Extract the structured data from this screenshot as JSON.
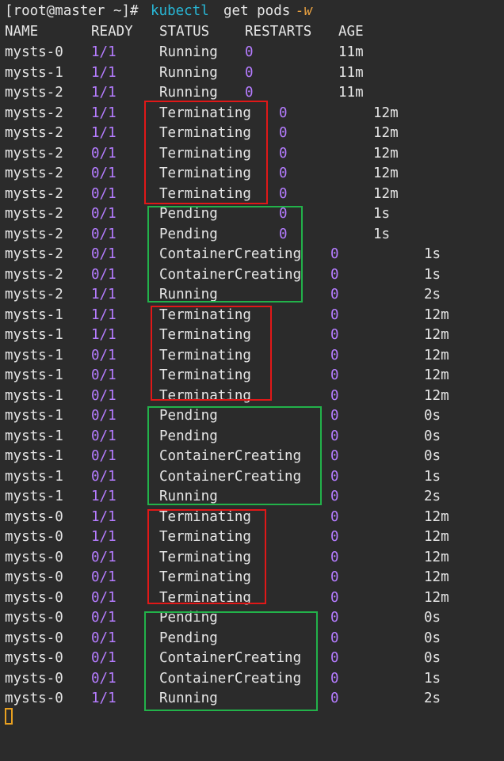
{
  "terminal": {
    "prompt": "[root@master ~]#",
    "command": "kubectl",
    "args": "get pods",
    "flag": "-w",
    "header": {
      "name": "NAME",
      "ready": "READY",
      "status": "STATUS",
      "restarts": "RESTARTS",
      "age": "AGE"
    },
    "rows": [
      {
        "name": "mysts-0",
        "ready": "1/1",
        "status": "Running",
        "restarts": "0",
        "age": "11m"
      },
      {
        "name": "mysts-1",
        "ready": "1/1",
        "status": "Running",
        "restarts": "0",
        "age": "11m"
      },
      {
        "name": "mysts-2",
        "ready": "1/1",
        "status": "Running",
        "restarts": "0",
        "age": "11m"
      },
      {
        "name": "mysts-2",
        "ready": "1/1",
        "status": "Terminating",
        "restarts": "0",
        "age": "12m"
      },
      {
        "name": "mysts-2",
        "ready": "1/1",
        "status": "Terminating",
        "restarts": "0",
        "age": "12m"
      },
      {
        "name": "mysts-2",
        "ready": "0/1",
        "status": "Terminating",
        "restarts": "0",
        "age": "12m"
      },
      {
        "name": "mysts-2",
        "ready": "0/1",
        "status": "Terminating",
        "restarts": "0",
        "age": "12m"
      },
      {
        "name": "mysts-2",
        "ready": "0/1",
        "status": "Terminating",
        "restarts": "0",
        "age": "12m"
      },
      {
        "name": "mysts-2",
        "ready": "0/1",
        "status": "Pending",
        "restarts": "0",
        "age": "1s"
      },
      {
        "name": "mysts-2",
        "ready": "0/1",
        "status": "Pending",
        "restarts": "0",
        "age": "1s"
      },
      {
        "name": "mysts-2",
        "ready": "0/1",
        "status": "ContainerCreating",
        "restarts": "0",
        "age": "1s"
      },
      {
        "name": "mysts-2",
        "ready": "0/1",
        "status": "ContainerCreating",
        "restarts": "0",
        "age": "1s"
      },
      {
        "name": "mysts-2",
        "ready": "1/1",
        "status": "Running",
        "restarts": "0",
        "age": "2s"
      },
      {
        "name": "mysts-1",
        "ready": "1/1",
        "status": "Terminating",
        "restarts": "0",
        "age": "12m"
      },
      {
        "name": "mysts-1",
        "ready": "1/1",
        "status": "Terminating",
        "restarts": "0",
        "age": "12m"
      },
      {
        "name": "mysts-1",
        "ready": "0/1",
        "status": "Terminating",
        "restarts": "0",
        "age": "12m"
      },
      {
        "name": "mysts-1",
        "ready": "0/1",
        "status": "Terminating",
        "restarts": "0",
        "age": "12m"
      },
      {
        "name": "mysts-1",
        "ready": "0/1",
        "status": "Terminating",
        "restarts": "0",
        "age": "12m"
      },
      {
        "name": "mysts-1",
        "ready": "0/1",
        "status": "Pending",
        "restarts": "0",
        "age": "0s"
      },
      {
        "name": "mysts-1",
        "ready": "0/1",
        "status": "Pending",
        "restarts": "0",
        "age": "0s"
      },
      {
        "name": "mysts-1",
        "ready": "0/1",
        "status": "ContainerCreating",
        "restarts": "0",
        "age": "0s"
      },
      {
        "name": "mysts-1",
        "ready": "0/1",
        "status": "ContainerCreating",
        "restarts": "0",
        "age": "1s"
      },
      {
        "name": "mysts-1",
        "ready": "1/1",
        "status": "Running",
        "restarts": "0",
        "age": "2s"
      },
      {
        "name": "mysts-0",
        "ready": "1/1",
        "status": "Terminating",
        "restarts": "0",
        "age": "12m"
      },
      {
        "name": "mysts-0",
        "ready": "1/1",
        "status": "Terminating",
        "restarts": "0",
        "age": "12m"
      },
      {
        "name": "mysts-0",
        "ready": "0/1",
        "status": "Terminating",
        "restarts": "0",
        "age": "12m"
      },
      {
        "name": "mysts-0",
        "ready": "0/1",
        "status": "Terminating",
        "restarts": "0",
        "age": "12m"
      },
      {
        "name": "mysts-0",
        "ready": "0/1",
        "status": "Terminating",
        "restarts": "0",
        "age": "12m"
      },
      {
        "name": "mysts-0",
        "ready": "0/1",
        "status": "Pending",
        "restarts": "0",
        "age": "0s"
      },
      {
        "name": "mysts-0",
        "ready": "0/1",
        "status": "Pending",
        "restarts": "0",
        "age": "0s"
      },
      {
        "name": "mysts-0",
        "ready": "0/1",
        "status": "ContainerCreating",
        "restarts": "0",
        "age": "0s"
      },
      {
        "name": "mysts-0",
        "ready": "0/1",
        "status": "ContainerCreating",
        "restarts": "0",
        "age": "1s"
      },
      {
        "name": "mysts-0",
        "ready": "1/1",
        "status": "Running",
        "restarts": "0",
        "age": "2s"
      }
    ]
  },
  "colors": {
    "background": "#2b2b2b",
    "text": "#e6e6e6",
    "number": "#b57cff",
    "command": "#28b7d6",
    "flag": "#e8a040",
    "annotation_terminating": "#e01818",
    "annotation_recreating": "#22b24a",
    "cursor": "#e8a020"
  }
}
